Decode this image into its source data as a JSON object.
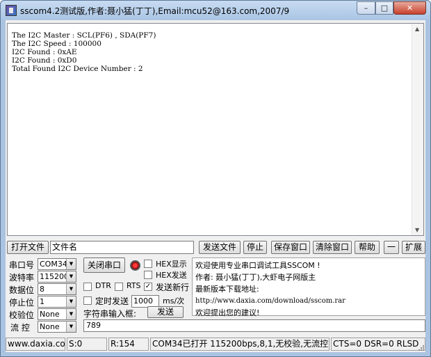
{
  "window": {
    "title": "sscom4.2测试版,作者:聂小猛(丁丁),Email:mcu52@163.com,2007/9",
    "controls": {
      "minimize": "–",
      "maximize": "□",
      "close": "✕"
    }
  },
  "receive": {
    "lines": [
      "The I2C Master : SCL(PF6) , SDA(PF7)",
      "The I2C Speed : 100000",
      "I2C Found : 0xAE",
      "I2C Found : 0xD0",
      "Total Found I2C Device Number : 2"
    ]
  },
  "toolbar": {
    "open_file": "打开文件",
    "file_name": "文件名",
    "send_file": "发送文件",
    "stop": "停止",
    "save_window": "保存窗口",
    "clear_window": "清除窗口",
    "help": "帮助",
    "dash": "一",
    "expand": "扩展"
  },
  "settings": {
    "port_label": "串口号",
    "port_value": "COM34",
    "baud_label": "波特率",
    "baud_value": "115200",
    "data_label": "数据位",
    "data_value": "8",
    "stop_label": "停止位",
    "stop_value": "1",
    "parity_label": "校验位",
    "parity_value": "None",
    "flow_label": "流 控",
    "flow_value": "None"
  },
  "controls": {
    "close_port": "关闭串口",
    "hex_display": "HEX显示",
    "hex_send": "HEX发送",
    "dtr": "DTR",
    "rts": "RTS",
    "send_newline": "发送新行",
    "timed_send": "定时发送",
    "interval_value": "1000",
    "interval_unit": "ms/次",
    "input_label": "字符串输入框:",
    "send": "发送",
    "send_text": "789",
    "send_newline_checked": "✓"
  },
  "info": {
    "line1": "欢迎使用专业串口调试工具SSCOM !",
    "line2": "作者: 聂小猛(丁丁),大虾电子网版主",
    "line3": "最新版本下载地址:",
    "line4": "http://www.daxia.com/download/sscom.rar",
    "line5": "欢迎提出您的建议!"
  },
  "status": {
    "site": "www.daxia.com",
    "sent": "S:0",
    "received": "R:154",
    "port_status": "COM34已打开  115200bps,8,1,无校验,无流控",
    "lines": "CTS=0 DSR=0 RLSD"
  }
}
